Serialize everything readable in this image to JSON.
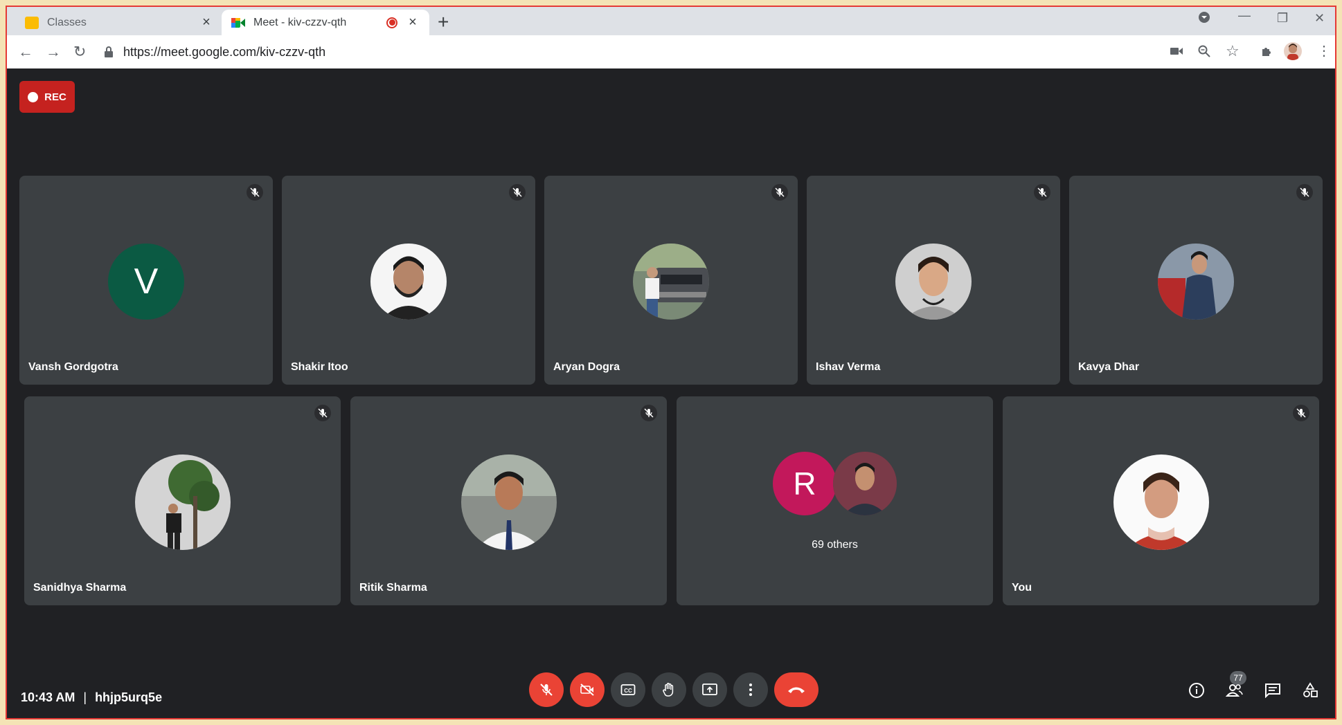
{
  "browser": {
    "tabs": [
      {
        "title": "Classes",
        "favicon": "google-classroom-icon",
        "active": false
      },
      {
        "title": "Meet - kiv-czzv-qth",
        "favicon": "google-meet-icon",
        "active": true,
        "recording": true
      }
    ],
    "url": "https://meet.google.com/kiv-czzv-qth"
  },
  "meet": {
    "rec_label": "REC",
    "participants_row1": [
      {
        "name": "Vansh Gordgotra",
        "initial": "V",
        "color": "#0b5a43"
      },
      {
        "name": "Shakir Itoo"
      },
      {
        "name": "Aryan Dogra"
      },
      {
        "name": "Ishav Verma"
      },
      {
        "name": "Kavya Dhar"
      }
    ],
    "participants_row2": [
      {
        "name": "Sanidhya Sharma"
      },
      {
        "name": "Ritik Sharma"
      },
      {
        "name": "",
        "others_initial": "R",
        "others_color": "#c2185b",
        "others_label": "69 others"
      },
      {
        "name": "You"
      }
    ],
    "time": "10:43 AM",
    "meeting_code": "hhjp5urq5e",
    "people_count": "77"
  },
  "colors": {
    "accent_red": "#ea4335",
    "bg": "#202124",
    "tile": "#3c4043"
  }
}
